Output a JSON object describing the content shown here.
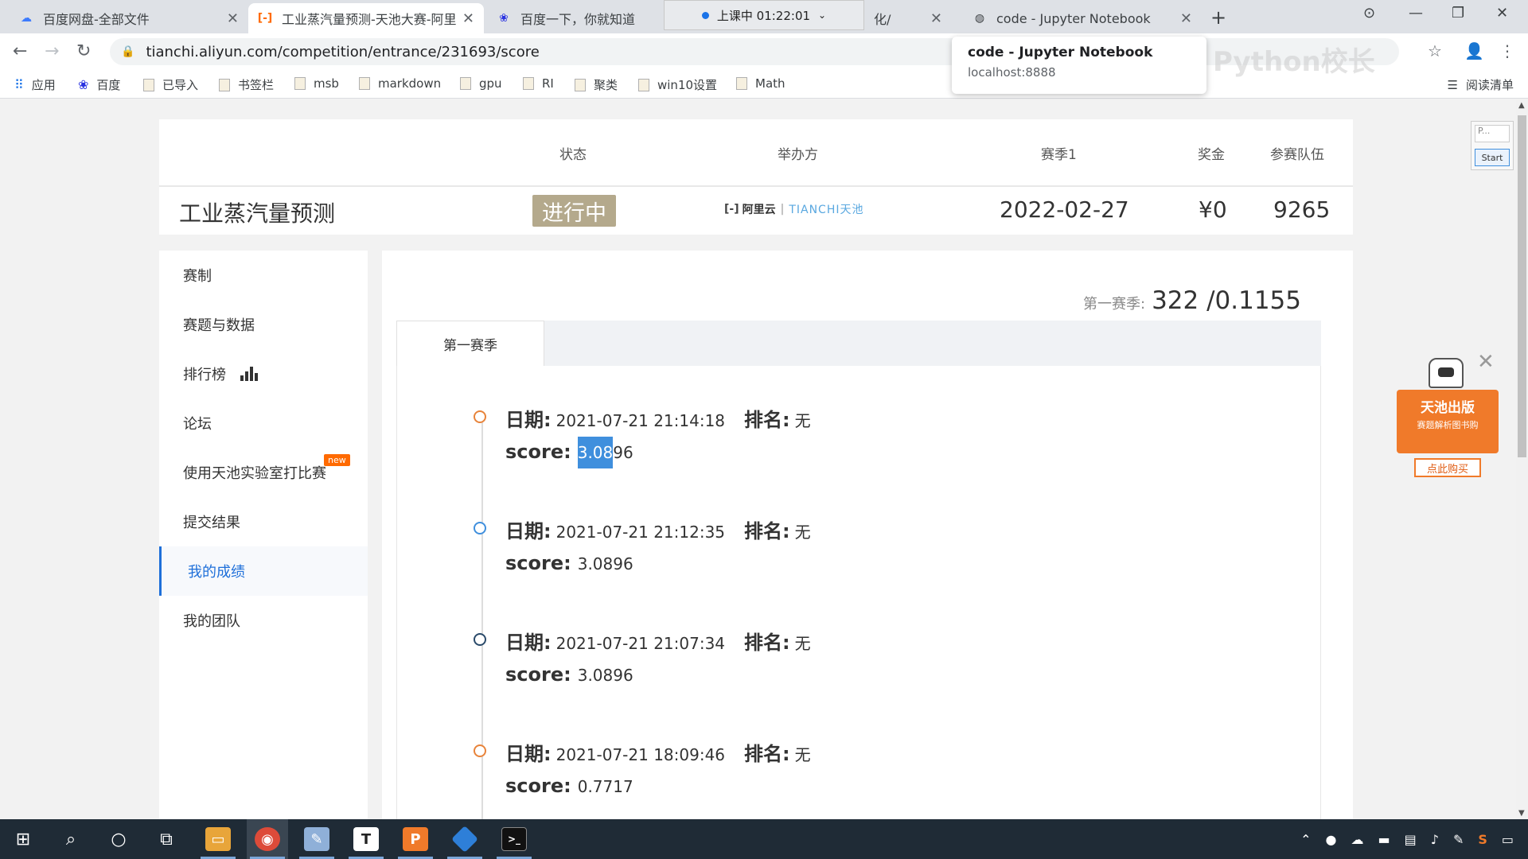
{
  "browser": {
    "tabs": [
      {
        "title": "百度网盘-全部文件",
        "icon": "baidu-netdisk-icon"
      },
      {
        "title": "工业蒸汽量预测-天池大赛-阿里云",
        "icon": "tianchi-icon"
      },
      {
        "title": "百度一下，你就知道",
        "icon": "baidu-paw-icon"
      },
      {
        "title": "化/",
        "icon": ""
      },
      {
        "title": "code - Jupyter Notebook",
        "icon": "globe-icon"
      }
    ],
    "recording_overlay": "上课中 01:22:01",
    "url": "tianchi.aliyun.com/competition/entrance/231693/score",
    "bookmarks": [
      "应用",
      "百度",
      "已导入",
      "书签栏",
      "msb",
      "markdown",
      "gpu",
      "RI",
      "聚类",
      "win10设置",
      "Math"
    ],
    "reading_list": "阅读清单",
    "tooltip": {
      "title": "code - Jupyter Notebook",
      "url": "localhost:8888"
    },
    "watermark": "Python校长"
  },
  "competition": {
    "headers": {
      "status": "状态",
      "organizer": "举办方",
      "season": "赛季1",
      "prize": "奖金",
      "teams": "参赛队伍"
    },
    "title": "工业蒸汽量预测",
    "status": "进行中",
    "organizer_logo": {
      "aliyun": "阿里云",
      "tianchi": "TIANCHI天池"
    },
    "season_date": "2022-02-27",
    "prize": "¥0",
    "teams": "9265"
  },
  "sidebar": {
    "items": [
      "赛制",
      "赛题与数据",
      "排行榜",
      "论坛",
      "使用天池实验室打比赛",
      "提交结果",
      "我的成绩",
      "我的团队"
    ],
    "new_badge": "new",
    "active": "我的成绩"
  },
  "main": {
    "season_label": "第一赛季:",
    "season_score": "322 /0.1155",
    "tab": "第一赛季",
    "labels": {
      "date": "日期:",
      "rank": "排名:",
      "score": "score:"
    },
    "records": [
      {
        "date": "2021-07-21 21:14:18",
        "rank": "无",
        "score_sel": "3.08",
        "score_rest": "96",
        "dot_color": "#e8833a"
      },
      {
        "date": "2021-07-21 21:12:35",
        "rank": "无",
        "score_sel": "",
        "score_rest": "3.0896",
        "dot_color": "#3f8fdd"
      },
      {
        "date": "2021-07-21 21:07:34",
        "rank": "无",
        "score_sel": "",
        "score_rest": "3.0896",
        "dot_color": "#2a4a6a"
      },
      {
        "date": "2021-07-21 18:09:46",
        "rank": "无",
        "score_sel": "",
        "score_rest": "0.7717",
        "dot_color": "#e8833a"
      }
    ]
  },
  "promo": {
    "title": "天池出版",
    "subtitle": "赛题解析图书购",
    "button": "点此购买"
  },
  "mini_widget": {
    "input": "P...",
    "button": "Start"
  }
}
